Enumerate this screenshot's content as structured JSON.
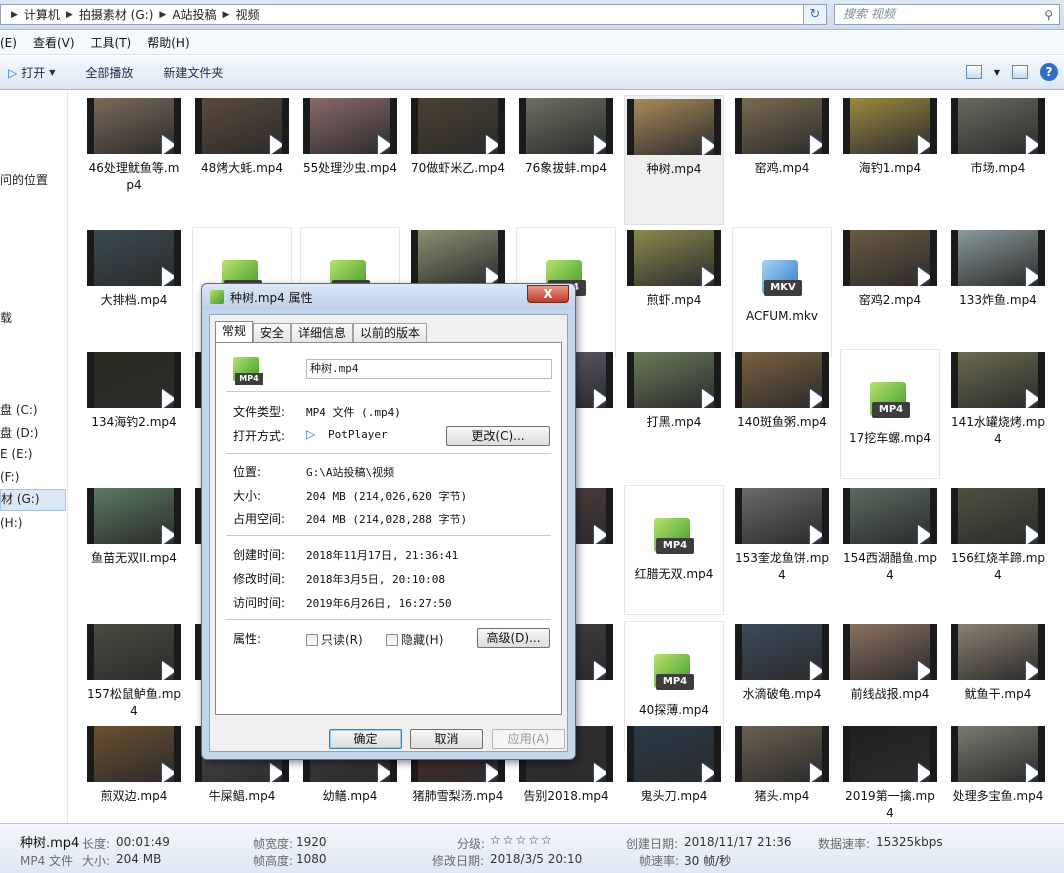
{
  "address": {
    "segments": [
      "计算机",
      "拍摄素材 (G:)",
      "A站投稿",
      "视频"
    ],
    "search_placeholder": "搜索 视频"
  },
  "menu": {
    "items": [
      "(E)",
      "查看(V)",
      "工具(T)",
      "帮助(H)"
    ]
  },
  "toolbar": {
    "open": "打开",
    "play_all": "全部播放",
    "new_folder": "新建文件夹"
  },
  "nav": {
    "items": [
      "问的位置",
      "载",
      "盘 (C:)",
      "盘 (D:)",
      "E (E:)",
      "(F:)",
      "材 (G:)",
      "(H:)"
    ]
  },
  "files": [
    {
      "name": "46处理鱿鱼等.mp4",
      "kind": "video",
      "color": "#7a6a58"
    },
    {
      "name": "48烤大蚝.mp4",
      "kind": "video",
      "color": "#5a4a3a"
    },
    {
      "name": "55处理沙虫.mp4",
      "kind": "video",
      "color": "#8a6a6a"
    },
    {
      "name": "70做虾米乙.mp4",
      "kind": "video",
      "color": "#4a4030"
    },
    {
      "name": "76象拔蚌.mp4",
      "kind": "video",
      "color": "#6a7060"
    },
    {
      "name": "种树.mp4",
      "kind": "video",
      "color": "#a88a5a",
      "selected": true
    },
    {
      "name": "窑鸡.mp4",
      "kind": "video",
      "color": "#7a6a50"
    },
    {
      "name": "海钓1.mp4",
      "kind": "video",
      "color": "#9a8a40"
    },
    {
      "name": "市场.mp4",
      "kind": "video",
      "color": "#6a6a60"
    },
    {
      "name": "大排档.mp4",
      "kind": "video",
      "color": "#3a4a50"
    },
    {
      "name": "",
      "kind": "mp4"
    },
    {
      "name": "",
      "kind": "mp4"
    },
    {
      "name": "",
      "kind": "video",
      "color": "#8a9070"
    },
    {
      "name": "",
      "kind": "mp4"
    },
    {
      "name": "煎虾.mp4",
      "kind": "video",
      "color": "#8a8a50"
    },
    {
      "name": "ACFUM.mkv",
      "kind": "mkv"
    },
    {
      "name": "窑鸡2.mp4",
      "kind": "video",
      "color": "#6a5a40"
    },
    {
      "name": "133炸鱼.mp4",
      "kind": "video",
      "color": "#8a9a9a"
    },
    {
      "name": "134海钓2.mp4",
      "kind": "video",
      "color": "#2a2a20"
    },
    {
      "name": "",
      "kind": "video",
      "color": "#607050"
    },
    {
      "name": "",
      "kind": "video",
      "color": "#606060"
    },
    {
      "name": "",
      "kind": "video",
      "color": "#707050"
    },
    {
      "name": "",
      "kind": "video",
      "color": "#606070"
    },
    {
      "name": "打黑.mp4",
      "kind": "video",
      "color": "#6a7a5a"
    },
    {
      "name": "140斑鱼粥.mp4",
      "kind": "video",
      "color": "#7a6040"
    },
    {
      "name": "17挖车螺.mp4",
      "kind": "mp4"
    },
    {
      "name": "141水罐烧烤.mp4",
      "kind": "video",
      "color": "#6a6a50"
    },
    {
      "name": "鱼苗无双II.mp4",
      "kind": "video",
      "color": "#5a7a60"
    },
    {
      "name": "",
      "kind": "video",
      "color": "#505050"
    },
    {
      "name": "",
      "kind": "video",
      "color": "#605040"
    },
    {
      "name": "",
      "kind": "video",
      "color": "#704030"
    },
    {
      "name": "",
      "kind": "video",
      "color": "#504040"
    },
    {
      "name": "红腊无双.mp4",
      "kind": "mp4"
    },
    {
      "name": "153奎龙鱼饼.mp4",
      "kind": "video",
      "color": "#6a6a6a"
    },
    {
      "name": "154西湖醋鱼.mp4",
      "kind": "video",
      "color": "#5a6a60"
    },
    {
      "name": "156红烧羊蹄.mp4",
      "kind": "video",
      "color": "#505040"
    },
    {
      "name": "157松鼠鲈鱼.mp4",
      "kind": "video",
      "color": "#4a4a40"
    },
    {
      "name": "",
      "kind": "video",
      "color": "#505050"
    },
    {
      "name": "",
      "kind": "video",
      "color": "#605040"
    },
    {
      "name": "",
      "kind": "video",
      "color": "#504030"
    },
    {
      "name": "",
      "kind": "video",
      "color": "#404040"
    },
    {
      "name": "40探薄.mp4",
      "kind": "mp4"
    },
    {
      "name": "水滴破龟.mp4",
      "kind": "video",
      "color": "#3a4a5a"
    },
    {
      "name": "前线战报.mp4",
      "kind": "video",
      "color": "#8a7060"
    },
    {
      "name": "鱿鱼干.mp4",
      "kind": "video",
      "color": "#8a8070"
    },
    {
      "name": "煎双边.mp4",
      "kind": "video",
      "color": "#6a5030"
    },
    {
      "name": "牛屎鲳.mp4",
      "kind": "video",
      "color": "#505050"
    },
    {
      "name": "幼鳝.mp4",
      "kind": "video",
      "color": "#404040"
    },
    {
      "name": "猪肺雪梨汤.mp4",
      "kind": "video",
      "color": "#503030"
    },
    {
      "name": "告别2018.mp4",
      "kind": "video",
      "color": "#303030"
    },
    {
      "name": "鬼头刀.mp4",
      "kind": "video",
      "color": "#2a3a4a"
    },
    {
      "name": "猪头.mp4",
      "kind": "video",
      "color": "#6a6050"
    },
    {
      "name": "2019第一擒.mp4",
      "kind": "video",
      "color": "#202020"
    },
    {
      "name": "处理多宝鱼.mp4",
      "kind": "video",
      "color": "#7a7a70"
    }
  ],
  "dialog": {
    "title": "种树.mp4 属性",
    "close": "X",
    "tabs": [
      "常规",
      "安全",
      "详细信息",
      "以前的版本"
    ],
    "filename": "种树.mp4",
    "icon_label": "MP4",
    "type_label": "文件类型:",
    "type_value": "MP4 文件 (.mp4)",
    "openwith_label": "打开方式:",
    "openwith_value": "PotPlayer",
    "change_button": "更改(C)...",
    "location_label": "位置:",
    "location_value": "G:\\A站投稿\\视频",
    "size_label": "大小:",
    "size_value": "204 MB (214,026,620 字节)",
    "disk_label": "占用空间:",
    "disk_value": "204 MB (214,028,288 字节)",
    "created_label": "创建时间:",
    "created_value": "2018年11月17日, 21:36:41",
    "modified_label": "修改时间:",
    "modified_value": "2018年3月5日, 20:10:08",
    "accessed_label": "访问时间:",
    "accessed_value": "2019年6月26日, 16:27:50",
    "attr_label": "属性:",
    "readonly": "只读(R)",
    "hidden": "隐藏(H)",
    "advanced": "高级(D)...",
    "ok": "确定",
    "cancel": "取消",
    "apply": "应用(A)"
  },
  "status": {
    "name": "种树.mp4",
    "type": "MP4 文件",
    "duration_k": "长度:",
    "duration_v": "00:01:49",
    "size_k": "大小:",
    "size_v": "204 MB",
    "fw_k": "帧宽度:",
    "fw_v": "1920",
    "fh_k": "帧高度:",
    "fh_v": "1080",
    "rating_k": "分级:",
    "mdate_k": "修改日期:",
    "mdate_v": "2018/3/5 20:10",
    "cdate_k": "创建日期:",
    "cdate_v": "2018/11/17 21:36",
    "rate_k": "帧速率:",
    "rate_v": "30 帧/秒",
    "bitrate_k": "数据速率:",
    "bitrate_v": "15325kbps"
  }
}
